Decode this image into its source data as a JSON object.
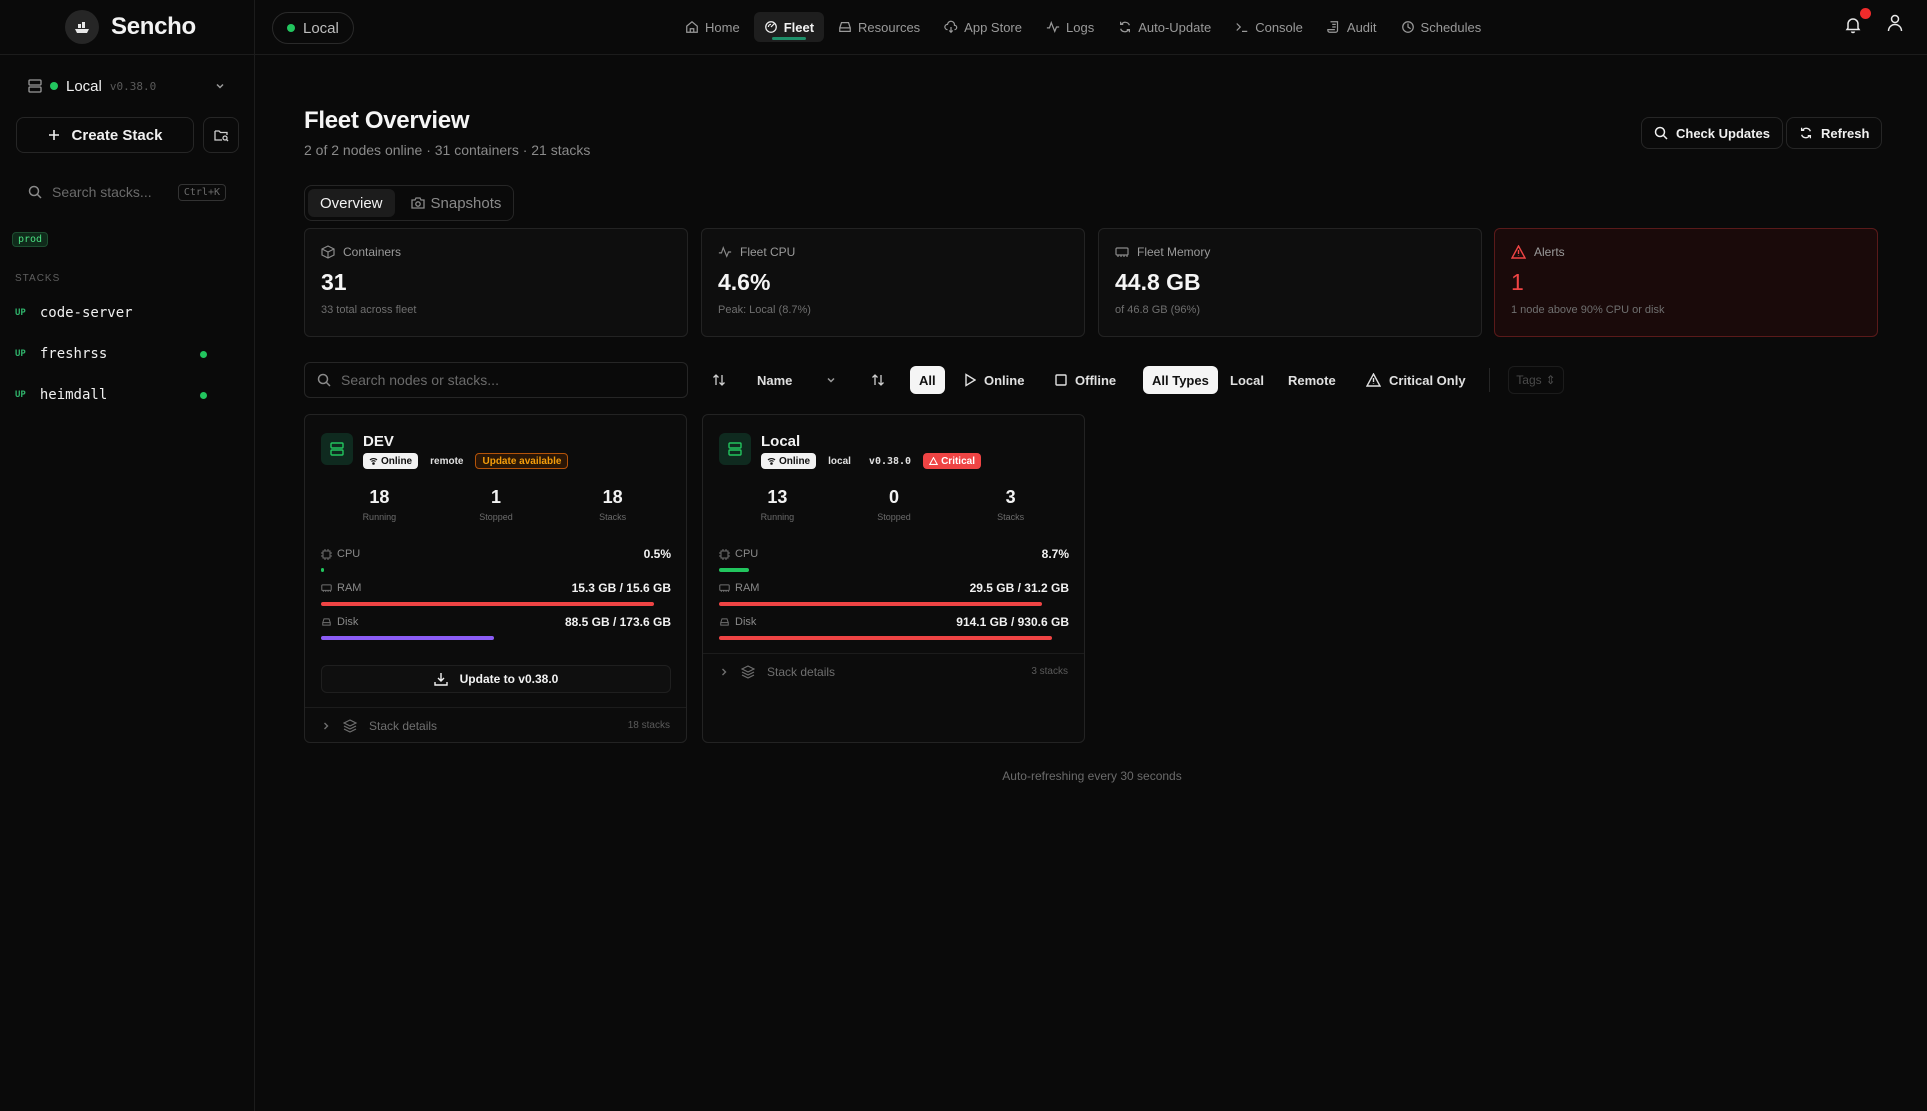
{
  "app": {
    "name": "Sencho"
  },
  "header": {
    "node_pill": "Local",
    "nav": [
      {
        "label": "Home",
        "icon": "home-icon"
      },
      {
        "label": "Fleet",
        "icon": "fleet-icon",
        "active": true
      },
      {
        "label": "Resources",
        "icon": "hard-drive-icon"
      },
      {
        "label": "App Store",
        "icon": "cloud-download-icon"
      },
      {
        "label": "Logs",
        "icon": "activity-icon"
      },
      {
        "label": "Auto-Update",
        "icon": "refresh-icon"
      },
      {
        "label": "Console",
        "icon": "terminal-icon"
      },
      {
        "label": "Audit",
        "icon": "scroll-icon"
      },
      {
        "label": "Schedules",
        "icon": "clock-icon"
      }
    ]
  },
  "sidebar": {
    "node_name": "Local",
    "node_version": "v0.38.0",
    "create_stack": "Create Stack",
    "search_placeholder": "Search stacks...",
    "search_shortcut": "Ctrl+K",
    "tag": "prod",
    "stacks_header": "STACKS",
    "stacks": [
      {
        "status": "UP",
        "name": "code-server",
        "dot": false
      },
      {
        "status": "UP",
        "name": "freshrss",
        "dot": true
      },
      {
        "status": "UP",
        "name": "heimdall",
        "dot": true
      }
    ]
  },
  "main": {
    "title": "Fleet Overview",
    "subtitle": "2 of 2 nodes online · 31 containers · 21 stacks",
    "check_updates": "Check Updates",
    "refresh": "Refresh",
    "tabs": {
      "overview": "Overview",
      "snapshots": "Snapshots"
    },
    "stats": {
      "containers": {
        "label": "Containers",
        "value": "31",
        "sub": "33 total across fleet"
      },
      "cpu": {
        "label": "Fleet CPU",
        "value": "4.6%",
        "sub": "Peak: Local (8.7%)"
      },
      "memory": {
        "label": "Fleet Memory",
        "value": "44.8 GB",
        "sub": "of 46.8 GB (96%)"
      },
      "alerts": {
        "label": "Alerts",
        "value": "1",
        "sub": "1 node above 90% CPU or disk"
      }
    },
    "filters": {
      "search_placeholder": "Search nodes or stacks...",
      "sort_label": "Name",
      "all": "All",
      "online": "Online",
      "offline": "Offline",
      "all_types": "All Types",
      "local": "Local",
      "remote": "Remote",
      "critical_only": "Critical Only",
      "tags": "Tags"
    },
    "nodes": {
      "dev": {
        "name": "DEV",
        "online": "Online",
        "type": "remote",
        "update_badge": "Update available",
        "running": "18",
        "running_label": "Running",
        "stopped": "1",
        "stopped_label": "Stopped",
        "stacks": "18",
        "stacks_label": "Stacks",
        "cpu_label": "CPU",
        "cpu_value": "0.5%",
        "cpu_pct": 0.5,
        "ram_label": "RAM",
        "ram_value": "15.3 GB / 15.6 GB",
        "ram_pct": 98,
        "disk_label": "Disk",
        "disk_value": "88.5 GB / 173.6 GB",
        "disk_pct": 51,
        "update_button": "Update to v0.38.0",
        "stack_details": "Stack details",
        "stack_count": "18 stacks"
      },
      "local": {
        "name": "Local",
        "online": "Online",
        "type": "local",
        "version": "v0.38.0",
        "critical": "Critical",
        "running": "13",
        "running_label": "Running",
        "stopped": "0",
        "stopped_label": "Stopped",
        "stacks": "3",
        "stacks_label": "Stacks",
        "cpu_label": "CPU",
        "cpu_value": "8.7%",
        "cpu_pct": 8.7,
        "ram_label": "RAM",
        "ram_value": "29.5 GB / 31.2 GB",
        "ram_pct": 95,
        "disk_label": "Disk",
        "disk_value": "914.1 GB / 930.6 GB",
        "disk_pct": 98,
        "stack_details": "Stack details",
        "stack_count": "3 stacks"
      }
    },
    "auto_refresh": "Auto-refreshing every 30 seconds"
  },
  "colors": {
    "accent": "#1f8f6a",
    "ok": "#22c55e",
    "danger": "#ef4444",
    "purple": "#8b5cf6",
    "warn": "#f59e0b"
  }
}
